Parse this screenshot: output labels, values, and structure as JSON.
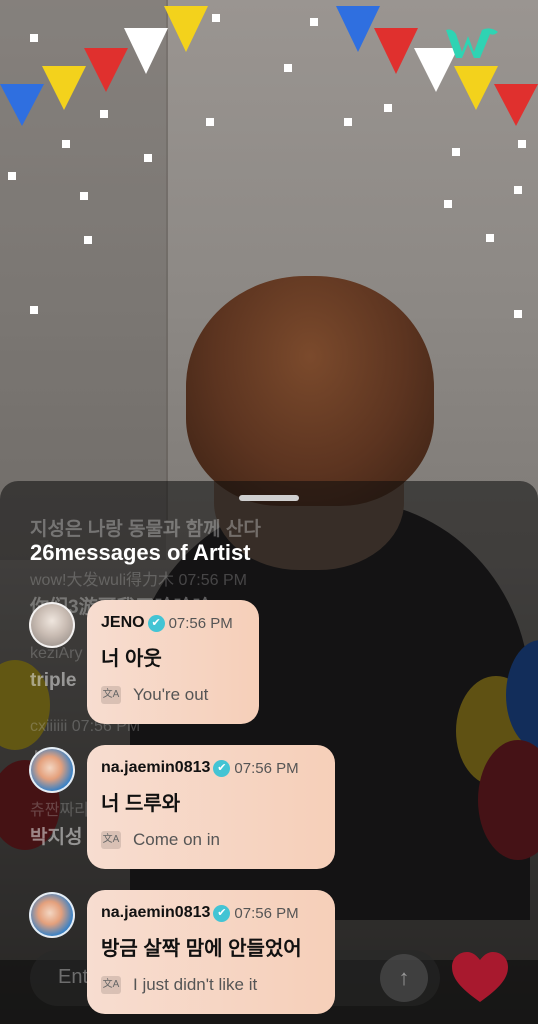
{
  "background_chat": {
    "lines": [
      "지성은 나랑 동물과 함께 산다",
      "wow!大发wuli得力木 07:56 PM",
      "你们3游哥我了哈哈哈",
      "keziAry",
      "triple",
      "cxiiiiii 07:56 PM",
      "서연",
      "츄짠짜리",
      "박지성"
    ]
  },
  "panel": {
    "heading": "26messages of Artist"
  },
  "messages": [
    {
      "nickname": "JENO",
      "time": "07:56 PM",
      "text": "너 아웃",
      "translation": "You're out"
    },
    {
      "nickname": "na.jaemin0813",
      "time": "07:56 PM",
      "text": "너 드루와",
      "translation": "Come on in"
    },
    {
      "nickname": "na.jaemin0813",
      "time": "07:56 PM",
      "text": "방금 살짝 맘에 안들었어",
      "translation": "I just didn't like it"
    }
  ],
  "input": {
    "placeholder": "Ent"
  },
  "icons": {
    "verified": "✔",
    "translate": "文A",
    "send": "↑"
  },
  "colors": {
    "bubble": "#f6d5c3",
    "verified": "#43c4d4",
    "heart": "#a8192e",
    "logo": "#2fd3b3"
  }
}
